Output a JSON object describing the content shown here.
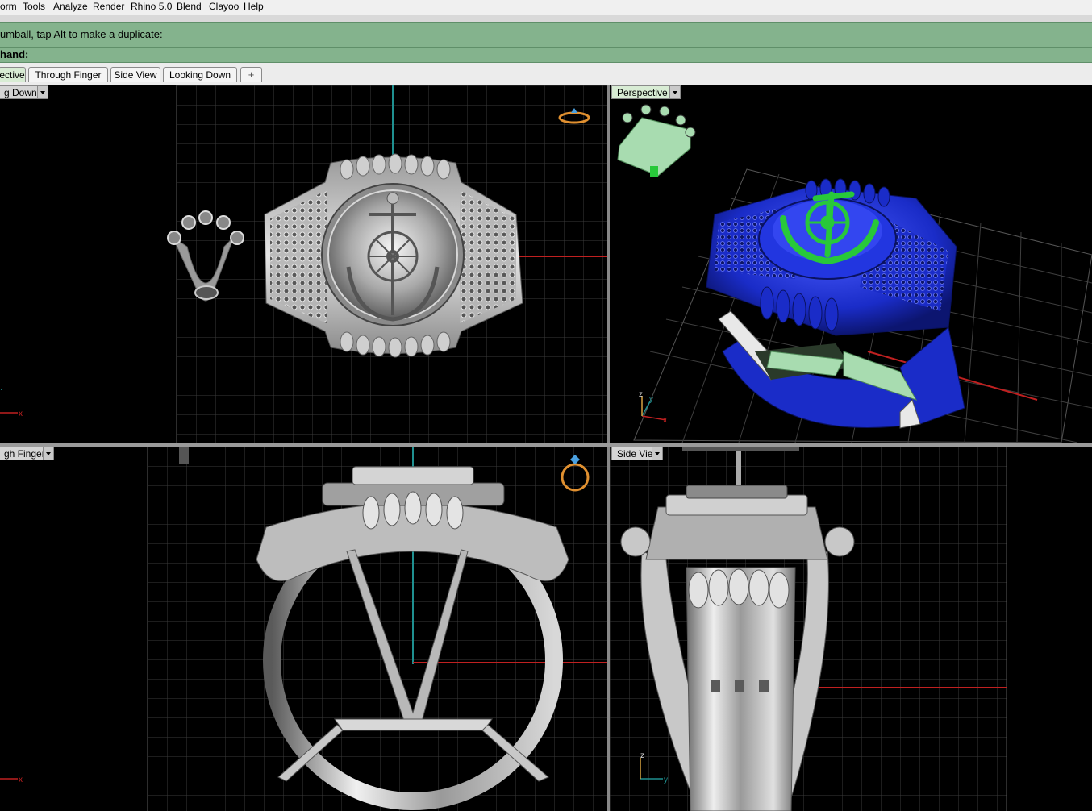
{
  "menu": [
    "orm",
    "Tools",
    "Analyze",
    "Render",
    "Rhino 5.0",
    "Blend",
    "Clayoo",
    "Help"
  ],
  "command": {
    "prompt": "umball, tap Alt to make a duplicate:",
    "label": "hand:"
  },
  "tabs": [
    {
      "label": "ective",
      "active": true
    },
    {
      "label": "Through Finger",
      "active": false
    },
    {
      "label": "Side View",
      "active": false
    },
    {
      "label": "Looking Down",
      "active": false
    },
    {
      "label": "+",
      "active": false
    }
  ],
  "viewports": {
    "top_left": {
      "title": "g Down",
      "axis_x": "x"
    },
    "top_right": {
      "title": "Perspective",
      "axis_x": "x",
      "axis_y": "y",
      "axis_z": "z"
    },
    "bottom_left": {
      "title": "gh Finger",
      "axis_x": "x"
    },
    "bottom_right": {
      "title": "Side View",
      "axis_y": "y",
      "axis_z": "z"
    }
  },
  "colors": {
    "command_bg": "#84b38d",
    "grid": "#3a3a3a",
    "grid_major": "#5a5a5a",
    "axis_x": "#c02020",
    "axis_y": "#1f9090",
    "silver": "#c8c8c8",
    "ring_blue": "#1a2cc8",
    "anchor_green": "#28c83a",
    "crown_mint": "#a8dcb0",
    "gold": "#e09030"
  }
}
